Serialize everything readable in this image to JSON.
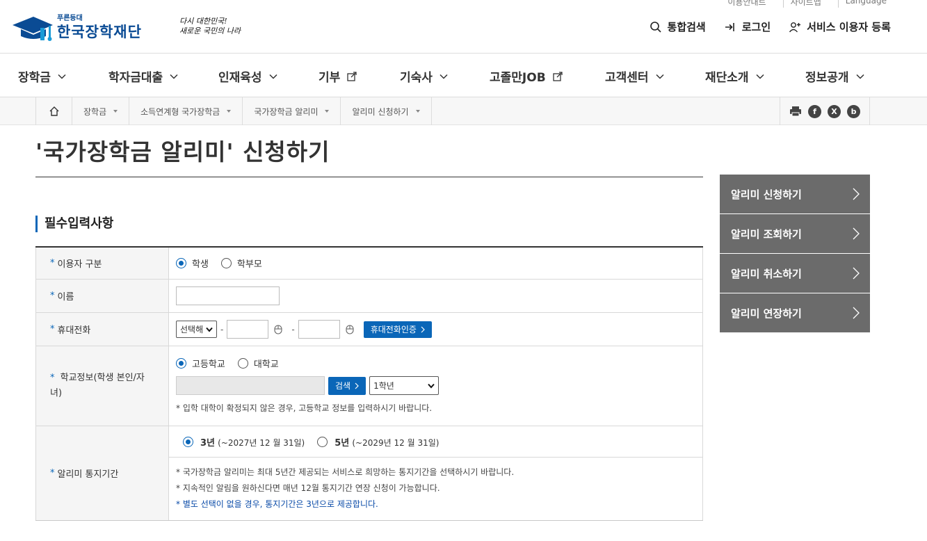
{
  "utility": {
    "items": [
      "이용안내트",
      "사이트맵",
      "Language"
    ]
  },
  "header": {
    "logo_small": "푸른등대",
    "logo_name": "한국장학재단",
    "slogan_line1": "다시 대한민국!",
    "slogan_line2": "새로운 국민의 나라",
    "search_label": "통합검색",
    "login_label": "로그인",
    "register_label": "서비스 이용자 등록"
  },
  "gnb": {
    "items": [
      {
        "label": "장학금",
        "icon": "chevron-down-icon"
      },
      {
        "label": "학자금대출",
        "icon": "chevron-down-icon"
      },
      {
        "label": "인재육성",
        "icon": "chevron-down-icon"
      },
      {
        "label": "기부",
        "icon": "external-link-icon"
      },
      {
        "label": "기숙사",
        "icon": "chevron-down-icon"
      },
      {
        "label": "고졸만JOB",
        "icon": "external-link-icon"
      },
      {
        "label": "고객센터",
        "icon": "chevron-down-icon"
      },
      {
        "label": "재단소개",
        "icon": "chevron-down-icon"
      },
      {
        "label": "정보공개",
        "icon": "chevron-down-icon"
      }
    ]
  },
  "breadcrumb": {
    "items": [
      "장학금",
      "소득연계형 국가장학금",
      "국가장학금 알리미",
      "알리미 신청하기"
    ],
    "share_icons": [
      "print-icon",
      "facebook-icon",
      "x-icon",
      "blog-icon"
    ],
    "share_glyphs": {
      "facebook": "f",
      "x": "X",
      "blog": "b"
    }
  },
  "page": {
    "title": "'국가장학금 알리미' 신청하기",
    "section_title": "필수입력사항"
  },
  "side_menu": {
    "items": [
      "알리미 신청하기",
      "알리미 조회하기",
      "알리미 취소하기",
      "알리미 연장하기"
    ]
  },
  "form": {
    "required_mark": "*",
    "user_type": {
      "label": "이용자 구분",
      "options": [
        "학생",
        "학부모"
      ],
      "selected": "학생"
    },
    "name": {
      "label": "이름",
      "value": ""
    },
    "phone": {
      "label": "휴대전화",
      "prefix_selected": "선택해",
      "middle": "",
      "last": "",
      "separator": "-",
      "verify_button": "휴대전화인증"
    },
    "school": {
      "label": "학교정보(학생 본인/자녀)",
      "options": [
        "고등학교",
        "대학교"
      ],
      "selected": "고등학교",
      "school_name": "",
      "search_button": "검색",
      "grade_selected": "1학년",
      "note": "* 입학 대학이 확정되지 않은 경우, 고등학교 정보를 입력하시기 바랍니다."
    },
    "period": {
      "label": "알리미 통지기간",
      "option1_bold": "3년",
      "option1_detail": "(~2027년 12 월 31일)",
      "option2_bold": "5년",
      "option2_detail": "(~2029년 12 월 31일)",
      "selected": "3년",
      "note1": "* 국가장학금 알리미는 최대 5년간 제공되는 서비스로 희망하는 통지기간을 선택하시기 바랍니다.",
      "note2": "* 지속적인 알림을 원하신다면 매년 12월 통지기간 연장 신청이 가능합니다.",
      "note3": "* 별도 선택이 없을 경우, 통지기간은 3년으로 제공합니다."
    }
  },
  "colors": {
    "brand_blue": "#0a66b8",
    "logo_blue": "#0a4b94",
    "side_menu_bg": "#6b6b6b"
  }
}
